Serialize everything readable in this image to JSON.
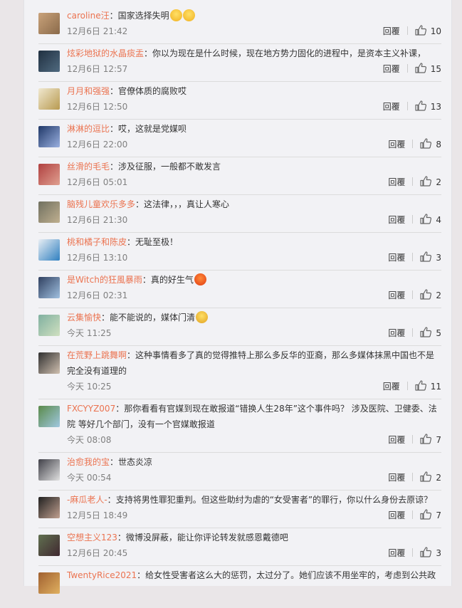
{
  "comments": [
    {
      "user": "caroline汪",
      "text": "国家选择失明",
      "emoji": "laugh-laugh",
      "time": "12月6日 21:42",
      "reply": "回覆",
      "likes": "10"
    },
    {
      "user": "炫彩地狱的水晶痰盂",
      "text": "你以为现在是什么时候，现在地方势力固化的进程中，是资本主义补课，",
      "emoji": "",
      "time": "12月6日 12:57",
      "reply": "回覆",
      "likes": "15"
    },
    {
      "user": "月月和强强",
      "text": "官僚体质的腐败哎",
      "emoji": "",
      "time": "12月6日 12:50",
      "reply": "回覆",
      "likes": "13"
    },
    {
      "user": "淋淋的逗比",
      "text": "哎，这就是党媒呗",
      "emoji": "",
      "time": "12月6日 22:00",
      "reply": "回覆",
      "likes": "8"
    },
    {
      "user": "丝滑的毛毛",
      "text": "涉及征服，一般都不敢发言",
      "emoji": "",
      "time": "12月6日 05:01",
      "reply": "回覆",
      "likes": "2"
    },
    {
      "user": "脑残儿童欢乐多多",
      "text": "这法律，，，真让人寒心",
      "emoji": "",
      "time": "12月6日 21:30",
      "reply": "回覆",
      "likes": "4"
    },
    {
      "user": "桃和橘子和陈皮",
      "text": "无耻至极！",
      "emoji": "",
      "time": "12月6日 13:10",
      "reply": "回覆",
      "likes": "3"
    },
    {
      "user": "是Witch的狂風暴雨",
      "text": "真的好生气",
      "emoji": "angry",
      "time": "12月6日 02:31",
      "reply": "回覆",
      "likes": "2"
    },
    {
      "user": "云集愉快",
      "text": "能不能说的，媒体门清",
      "emoji": "cry",
      "time": "今天 11:25",
      "reply": "回覆",
      "likes": "5"
    },
    {
      "user": "在荒野上跳舞啊",
      "text": "这种事情看多了真的觉得推特上那么多反华的亚裔，那么多媒体抹黑中国也不是完全没有道理的",
      "emoji": "",
      "time": "今天 10:25",
      "reply": "回覆",
      "likes": "11"
    },
    {
      "user": "FXCYYZ007",
      "text": "那你看看有官媒到现在敢报道“错换人生28年”这个事件吗？ 涉及医院、卫健委、法院 等好几个部门，没有一个官媒敢报道",
      "emoji": "",
      "time": "今天 08:08",
      "reply": "回覆",
      "likes": "7"
    },
    {
      "user": "治愈我的宝",
      "text": "世态炎凉",
      "emoji": "",
      "time": "今天 00:54",
      "reply": "回覆",
      "likes": "2"
    },
    {
      "user": "-麻瓜老人-",
      "text": "支持将男性罪犯重判。但这些助纣为虐的“女受害者”的罪行，你以什么身份去原谅？",
      "emoji": "",
      "time": "12月5日 18:49",
      "reply": "回覆",
      "likes": "7"
    },
    {
      "user": "空想主义123",
      "text": "微博没屏蔽，能让你评论转发就感恩戴德吧",
      "emoji": "",
      "time": "12月6日 20:45",
      "reply": "回覆",
      "likes": "3"
    },
    {
      "user": "TwentyRice2021",
      "text": "给女性受害者这么大的惩罚，太过分了。她们应该不用坐牢的，考虑到公共政",
      "emoji": "",
      "time": "",
      "reply": "",
      "likes": ""
    }
  ],
  "colors": {
    "username": "#eb7350",
    "time": "#808080",
    "panel": "#f2f2f5",
    "page": "#eae6e8"
  }
}
